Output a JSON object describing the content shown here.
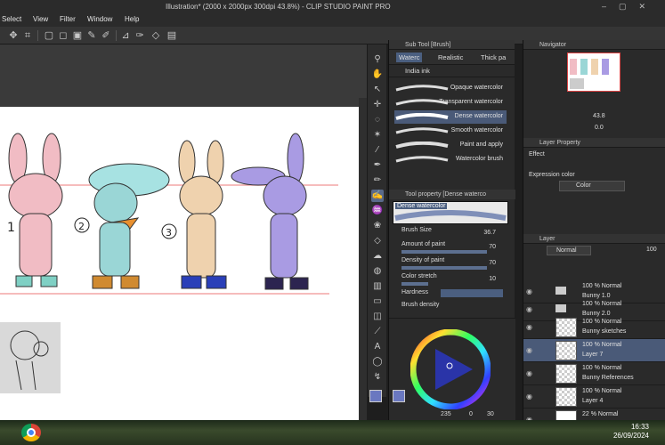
{
  "window": {
    "title": "Illustration* (2000 x 2000px 300dpi 43.8%) - CLIP STUDIO PAINT PRO"
  },
  "menu": {
    "items": [
      "Select",
      "View",
      "Filter",
      "Window",
      "Help"
    ]
  },
  "subtool": {
    "panel_title": "Sub Tool [Brush]",
    "tabs": [
      "Waterc",
      "Realistic",
      "Thick pa",
      "India ink"
    ],
    "brushes": [
      "Opaque watercolor",
      "Transparent watercolor",
      "Dense watercolor",
      "Smooth watercolor",
      "Paint and apply",
      "Watercolor brush"
    ],
    "selected": "Dense watercolor"
  },
  "tool_property": {
    "panel_title": "Tool property [Dense waterco",
    "preview_name": "Dense watercolor",
    "props": [
      {
        "name": "Brush Size",
        "value": "36.7"
      },
      {
        "name": "Amount of paint",
        "value": "70"
      },
      {
        "name": "Density of paint",
        "value": "70"
      },
      {
        "name": "Color stretch",
        "value": "10"
      },
      {
        "name": "Hardness",
        "value": ""
      },
      {
        "name": "Brush density",
        "value": ""
      }
    ]
  },
  "color": {
    "readout": "235",
    "g": "0",
    "b": "30",
    "accent": "#4b5f80"
  },
  "navigator": {
    "panel_title": "Navigator",
    "zoom": "43.8",
    "rotation": "0.0"
  },
  "layer_property": {
    "panel_title": "Layer Property",
    "effect_label": "Effect",
    "expression_label": "Expression color",
    "expression_value": "Color"
  },
  "layers": {
    "panel_title": "Layer",
    "blend_mode": "Normal",
    "opacity": "100",
    "rows": [
      {
        "mode": "100 % Normal",
        "name": "Bunny 1.0",
        "type": "folder"
      },
      {
        "mode": "100 % Normal",
        "name": "Bunny 2.0",
        "type": "folder"
      },
      {
        "mode": "100 % Normal",
        "name": "Bunny sketches",
        "type": "layer"
      },
      {
        "mode": "100 % Normal",
        "name": "Layer 7",
        "type": "layer",
        "selected": true
      },
      {
        "mode": "100 % Normal",
        "name": "Bunny References",
        "type": "layer"
      },
      {
        "mode": "100 % Normal",
        "name": "Layer 4",
        "type": "layer"
      },
      {
        "mode": "22 % Normal",
        "name": "",
        "type": "layer"
      }
    ]
  },
  "taskbar": {
    "time": "16:33",
    "date": "26/09/2024"
  }
}
